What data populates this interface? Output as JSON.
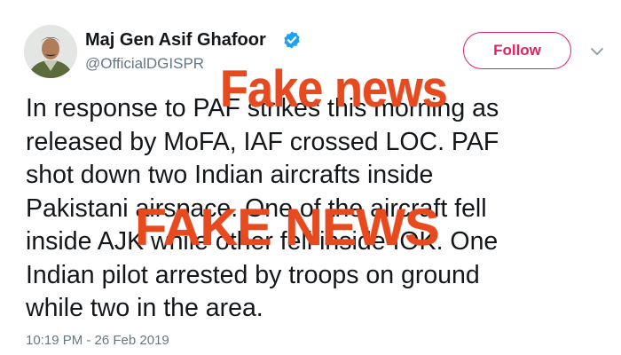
{
  "author": {
    "display_name": "Maj Gen Asif Ghafoor",
    "handle": "@OfficialDGISPR",
    "verified": true,
    "avatar": "profile-photo"
  },
  "actions": {
    "follow_label": "Follow",
    "menu_icon": "chevron-down-icon"
  },
  "tweet": {
    "text": "In response to PAF strikes this morning as\nreleased by MoFA, IAF crossed LOC. PAF\nshot down two Indian aircrafts inside\nPakistani airspace. One of the aircraft fell\ninside AJK while other fell inside IOK. One\nIndian pilot arrested by troops on ground\nwhile two in the area.",
    "timestamp": "10:19 PM - 26 Feb 2019"
  },
  "overlays": {
    "stamp_top": "Fake news",
    "stamp_bottom": "FAKE NEWS",
    "stamp_color": "#e84a1f"
  },
  "colors": {
    "follow_accent": "#e0245e",
    "verified_blue": "#1da1f2",
    "secondary_text": "#657786"
  }
}
